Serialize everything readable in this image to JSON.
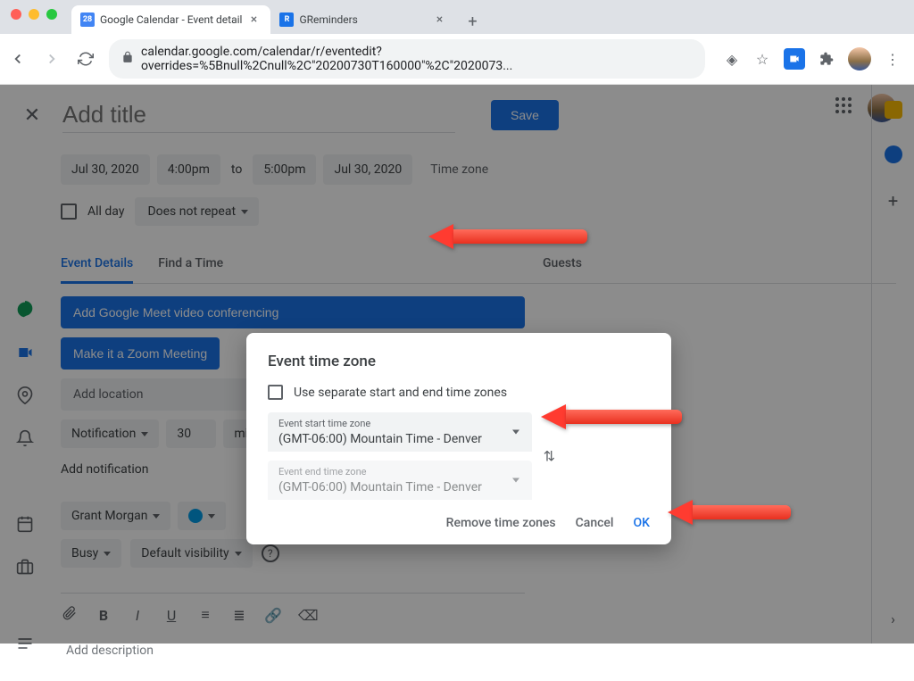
{
  "browser": {
    "tabs": [
      {
        "title": "Google Calendar - Event detail",
        "iconText": "28",
        "iconBg": "#4285f4"
      },
      {
        "title": "GReminders",
        "iconText": "R",
        "iconBg": "#1a73e8"
      }
    ],
    "url": "calendar.google.com/calendar/r/eventedit?overrides=%5Bnull%2Cnull%2C\"20200730T160000\"%2C\"2020073..."
  },
  "header": {
    "titlePlaceholder": "Add title",
    "saveLabel": "Save"
  },
  "datetime": {
    "startDate": "Jul 30, 2020",
    "startTime": "4:00pm",
    "toLabel": "to",
    "endTime": "5:00pm",
    "endDate": "Jul 30, 2020",
    "timezoneLabel": "Time zone",
    "allDayLabel": "All day",
    "repeatLabel": "Does not repeat"
  },
  "tabs": {
    "details": "Event Details",
    "findTime": "Find a Time",
    "guests": "Guests"
  },
  "fields": {
    "addMeet": "Add Google Meet video conferencing",
    "addZoom": "Make it a Zoom Meeting",
    "locationPlaceholder": "Add location",
    "notificationLabel": "Notification",
    "notifValue": "30",
    "notifUnit": "minutes",
    "addNotif": "Add notification",
    "owner": "Grant Morgan",
    "busy": "Busy",
    "visibility": "Default visibility",
    "descPlaceholder": "Add description"
  },
  "dialog": {
    "title": "Event time zone",
    "separateLabel": "Use separate start and end time zones",
    "startLabel": "Event start time zone",
    "startValue": "(GMT-06:00) Mountain Time - Denver",
    "endLabel": "Event end time zone",
    "endValue": "(GMT-06:00) Mountain Time - Denver",
    "removeLabel": "Remove time zones",
    "cancelLabel": "Cancel",
    "okLabel": "OK"
  }
}
